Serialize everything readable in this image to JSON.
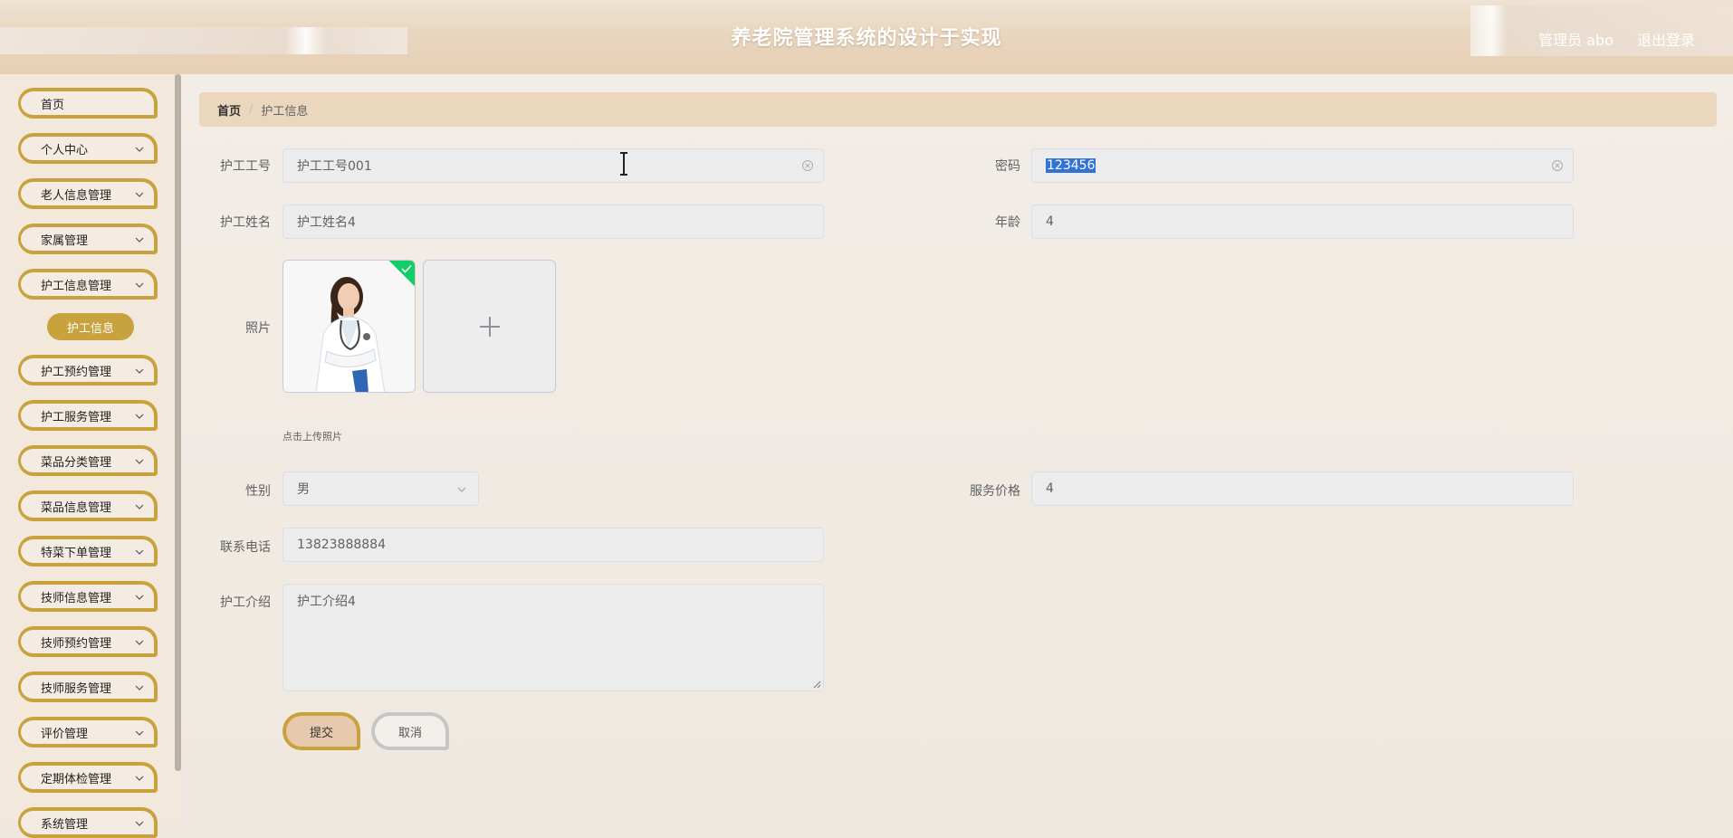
{
  "header": {
    "title": "养老院管理系统的设计于实现",
    "user": "管理员 abo",
    "logout": "退出登录"
  },
  "sidebar": {
    "items": [
      {
        "label": "首页",
        "expandable": false
      },
      {
        "label": "个人中心",
        "expandable": true
      },
      {
        "label": "老人信息管理",
        "expandable": true
      },
      {
        "label": "家属管理",
        "expandable": true
      },
      {
        "label": "护工信息管理",
        "expandable": true
      },
      {
        "label": "护工预约管理",
        "expandable": true
      },
      {
        "label": "护工服务管理",
        "expandable": true
      },
      {
        "label": "菜品分类管理",
        "expandable": true
      },
      {
        "label": "菜品信息管理",
        "expandable": true
      },
      {
        "label": "特菜下单管理",
        "expandable": true
      },
      {
        "label": "技师信息管理",
        "expandable": true
      },
      {
        "label": "技师预约管理",
        "expandable": true
      },
      {
        "label": "技师服务管理",
        "expandable": true
      },
      {
        "label": "评价管理",
        "expandable": true
      },
      {
        "label": "定期体检管理",
        "expandable": true
      },
      {
        "label": "系统管理",
        "expandable": true
      }
    ],
    "active_submenu": "护工信息"
  },
  "breadcrumb": {
    "home": "首页",
    "separator": "/",
    "current": "护工信息"
  },
  "form": {
    "worker_id": {
      "label": "护工工号",
      "value": "护工工号001"
    },
    "password": {
      "label": "密码",
      "value": "123456"
    },
    "worker_name": {
      "label": "护工姓名",
      "value": "护工姓名4"
    },
    "age": {
      "label": "年龄",
      "value": "4"
    },
    "photo": {
      "label": "照片",
      "hint": "点击上传照片"
    },
    "gender": {
      "label": "性别",
      "value": "男"
    },
    "service_price": {
      "label": "服务价格",
      "value": "4"
    },
    "phone": {
      "label": "联系电话",
      "value": "13823888884"
    },
    "intro": {
      "label": "护工介绍",
      "value": "护工介绍4"
    },
    "submit": "提交",
    "cancel": "取消"
  },
  "colors": {
    "accent_gold": "#c8a23c",
    "breadcrumb_bg": "#ead7bd",
    "success_badge": "#13ce66",
    "selection": "#3373d8"
  }
}
